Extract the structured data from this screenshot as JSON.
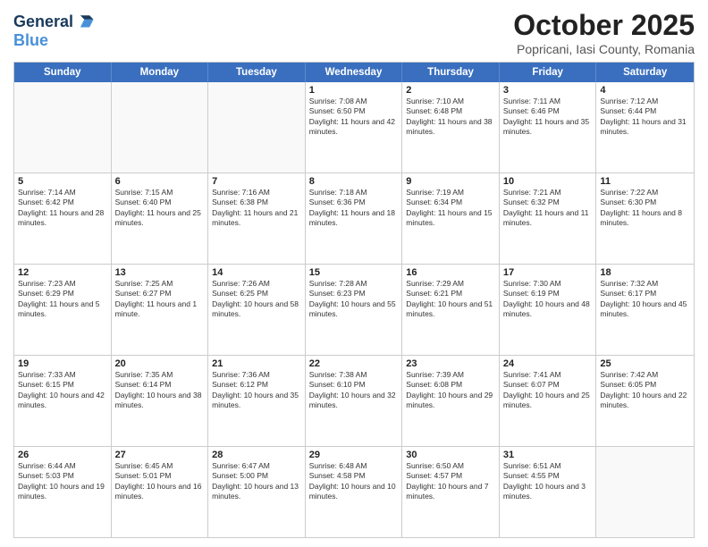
{
  "header": {
    "logo_line1": "General",
    "logo_line2": "Blue",
    "month": "October 2025",
    "location": "Popricani, Iasi County, Romania"
  },
  "weekdays": [
    "Sunday",
    "Monday",
    "Tuesday",
    "Wednesday",
    "Thursday",
    "Friday",
    "Saturday"
  ],
  "rows": [
    [
      {
        "day": "",
        "info": ""
      },
      {
        "day": "",
        "info": ""
      },
      {
        "day": "",
        "info": ""
      },
      {
        "day": "1",
        "info": "Sunrise: 7:08 AM\nSunset: 6:50 PM\nDaylight: 11 hours and 42 minutes."
      },
      {
        "day": "2",
        "info": "Sunrise: 7:10 AM\nSunset: 6:48 PM\nDaylight: 11 hours and 38 minutes."
      },
      {
        "day": "3",
        "info": "Sunrise: 7:11 AM\nSunset: 6:46 PM\nDaylight: 11 hours and 35 minutes."
      },
      {
        "day": "4",
        "info": "Sunrise: 7:12 AM\nSunset: 6:44 PM\nDaylight: 11 hours and 31 minutes."
      }
    ],
    [
      {
        "day": "5",
        "info": "Sunrise: 7:14 AM\nSunset: 6:42 PM\nDaylight: 11 hours and 28 minutes."
      },
      {
        "day": "6",
        "info": "Sunrise: 7:15 AM\nSunset: 6:40 PM\nDaylight: 11 hours and 25 minutes."
      },
      {
        "day": "7",
        "info": "Sunrise: 7:16 AM\nSunset: 6:38 PM\nDaylight: 11 hours and 21 minutes."
      },
      {
        "day": "8",
        "info": "Sunrise: 7:18 AM\nSunset: 6:36 PM\nDaylight: 11 hours and 18 minutes."
      },
      {
        "day": "9",
        "info": "Sunrise: 7:19 AM\nSunset: 6:34 PM\nDaylight: 11 hours and 15 minutes."
      },
      {
        "day": "10",
        "info": "Sunrise: 7:21 AM\nSunset: 6:32 PM\nDaylight: 11 hours and 11 minutes."
      },
      {
        "day": "11",
        "info": "Sunrise: 7:22 AM\nSunset: 6:30 PM\nDaylight: 11 hours and 8 minutes."
      }
    ],
    [
      {
        "day": "12",
        "info": "Sunrise: 7:23 AM\nSunset: 6:29 PM\nDaylight: 11 hours and 5 minutes."
      },
      {
        "day": "13",
        "info": "Sunrise: 7:25 AM\nSunset: 6:27 PM\nDaylight: 11 hours and 1 minute."
      },
      {
        "day": "14",
        "info": "Sunrise: 7:26 AM\nSunset: 6:25 PM\nDaylight: 10 hours and 58 minutes."
      },
      {
        "day": "15",
        "info": "Sunrise: 7:28 AM\nSunset: 6:23 PM\nDaylight: 10 hours and 55 minutes."
      },
      {
        "day": "16",
        "info": "Sunrise: 7:29 AM\nSunset: 6:21 PM\nDaylight: 10 hours and 51 minutes."
      },
      {
        "day": "17",
        "info": "Sunrise: 7:30 AM\nSunset: 6:19 PM\nDaylight: 10 hours and 48 minutes."
      },
      {
        "day": "18",
        "info": "Sunrise: 7:32 AM\nSunset: 6:17 PM\nDaylight: 10 hours and 45 minutes."
      }
    ],
    [
      {
        "day": "19",
        "info": "Sunrise: 7:33 AM\nSunset: 6:15 PM\nDaylight: 10 hours and 42 minutes."
      },
      {
        "day": "20",
        "info": "Sunrise: 7:35 AM\nSunset: 6:14 PM\nDaylight: 10 hours and 38 minutes."
      },
      {
        "day": "21",
        "info": "Sunrise: 7:36 AM\nSunset: 6:12 PM\nDaylight: 10 hours and 35 minutes."
      },
      {
        "day": "22",
        "info": "Sunrise: 7:38 AM\nSunset: 6:10 PM\nDaylight: 10 hours and 32 minutes."
      },
      {
        "day": "23",
        "info": "Sunrise: 7:39 AM\nSunset: 6:08 PM\nDaylight: 10 hours and 29 minutes."
      },
      {
        "day": "24",
        "info": "Sunrise: 7:41 AM\nSunset: 6:07 PM\nDaylight: 10 hours and 25 minutes."
      },
      {
        "day": "25",
        "info": "Sunrise: 7:42 AM\nSunset: 6:05 PM\nDaylight: 10 hours and 22 minutes."
      }
    ],
    [
      {
        "day": "26",
        "info": "Sunrise: 6:44 AM\nSunset: 5:03 PM\nDaylight: 10 hours and 19 minutes."
      },
      {
        "day": "27",
        "info": "Sunrise: 6:45 AM\nSunset: 5:01 PM\nDaylight: 10 hours and 16 minutes."
      },
      {
        "day": "28",
        "info": "Sunrise: 6:47 AM\nSunset: 5:00 PM\nDaylight: 10 hours and 13 minutes."
      },
      {
        "day": "29",
        "info": "Sunrise: 6:48 AM\nSunset: 4:58 PM\nDaylight: 10 hours and 10 minutes."
      },
      {
        "day": "30",
        "info": "Sunrise: 6:50 AM\nSunset: 4:57 PM\nDaylight: 10 hours and 7 minutes."
      },
      {
        "day": "31",
        "info": "Sunrise: 6:51 AM\nSunset: 4:55 PM\nDaylight: 10 hours and 3 minutes."
      },
      {
        "day": "",
        "info": ""
      }
    ]
  ]
}
